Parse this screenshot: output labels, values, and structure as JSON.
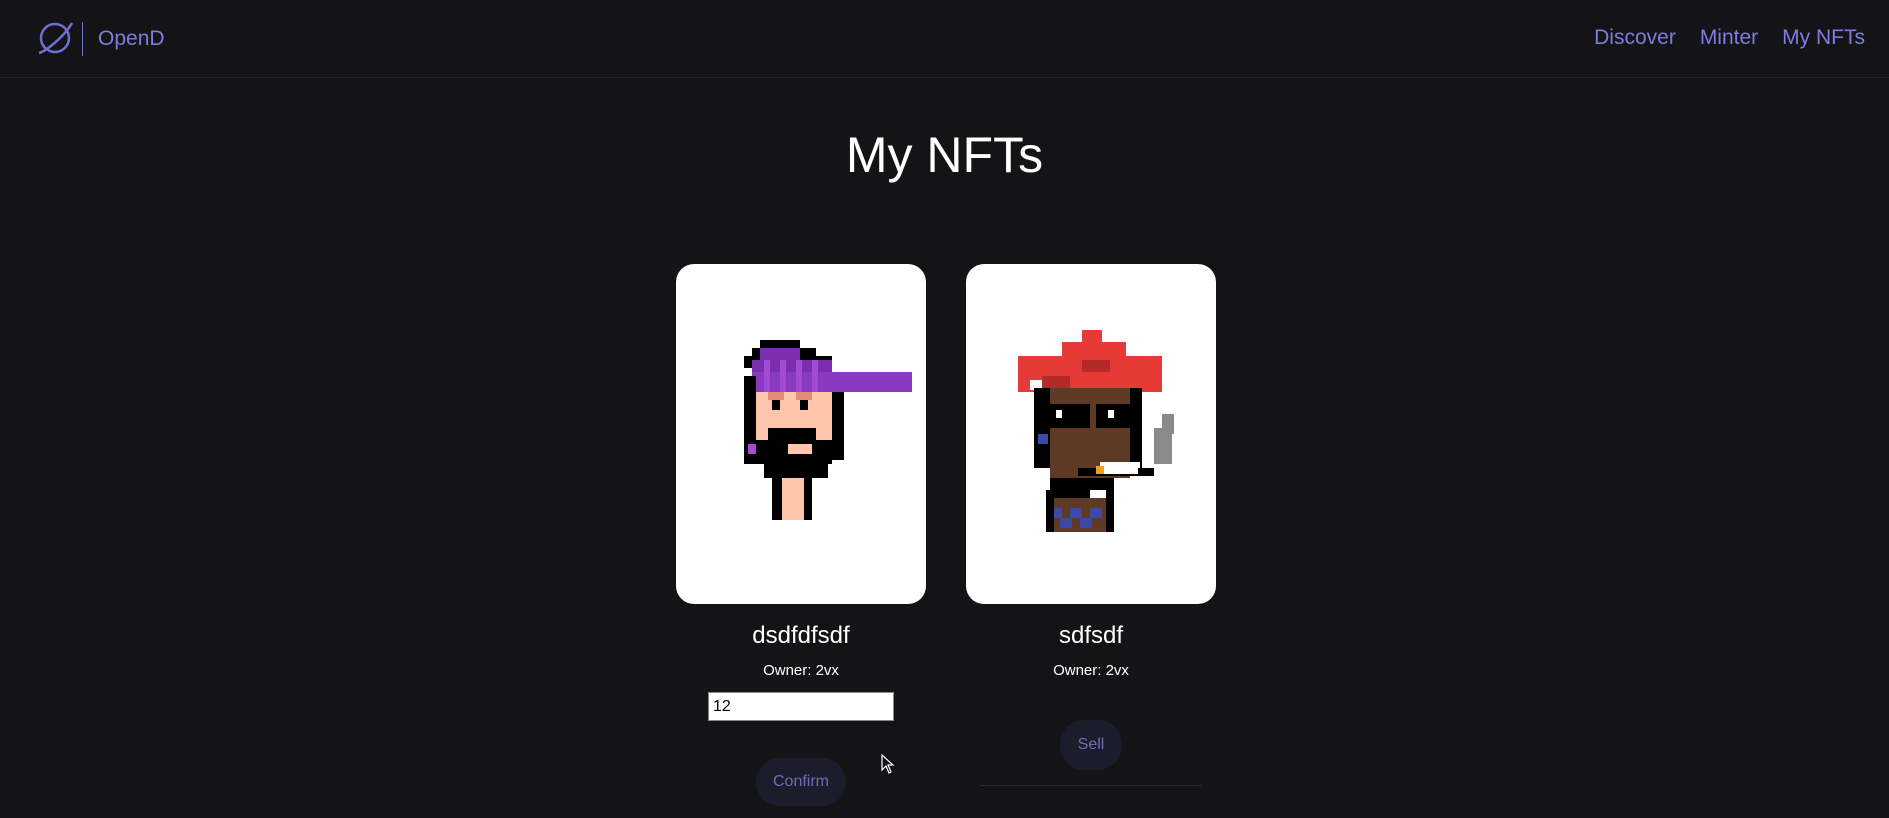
{
  "header": {
    "brand": "OpenD",
    "logo_icon": "planet-icon",
    "nav": [
      "Discover",
      "Minter",
      "My NFTs"
    ]
  },
  "main": {
    "title": "My NFTs"
  },
  "cards": [
    {
      "name": "dsdfdfsdf",
      "owner": "Owner: 2vx",
      "price_value": "12",
      "button_label": "Confirm",
      "image_icon": "pixel-punk-purple-cap"
    },
    {
      "name": "sdfsdf",
      "owner": "Owner: 2vx",
      "button_label": "Sell",
      "image_icon": "pixel-punk-red-hair"
    }
  ],
  "colors": {
    "background": "#141416",
    "accent": "#7d7ddf",
    "button_bg": "#1b1d2c"
  }
}
